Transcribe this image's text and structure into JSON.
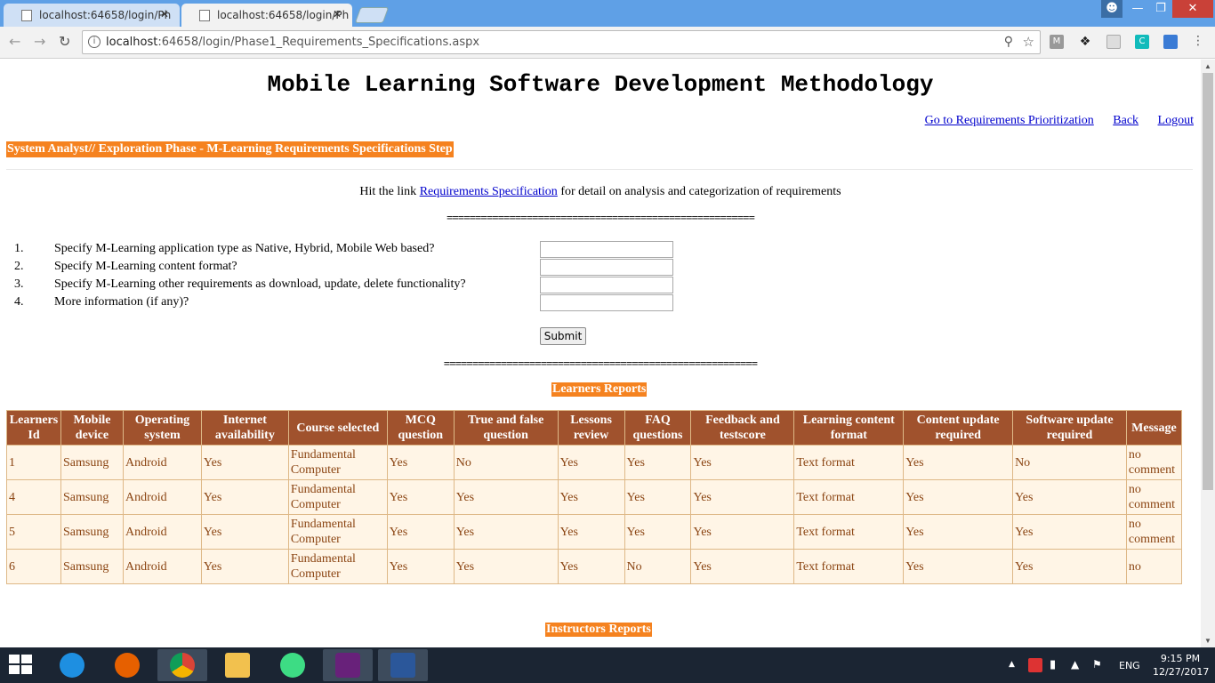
{
  "browser": {
    "tabs": [
      {
        "title": "localhost:64658/login/Ph",
        "close": "✕"
      },
      {
        "title": "localhost:64658/login/Ph",
        "close": "✕"
      }
    ],
    "url_host": "localhost",
    "url_rest": ":64658/login/Phase1_Requirements_Specifications.aspx",
    "ext_m_label": "M",
    "ext_c_label": "C"
  },
  "page": {
    "title": "Mobile Learning Software Development Methodology",
    "links": {
      "prioritization": "Go to Requirements Prioritization",
      "back": "Back",
      "logout": "Logout"
    },
    "phase_label": "System Analyst//  Exploration Phase - M-Learning Requirements Specifications Step",
    "hint_before": "Hit the link ",
    "hint_link": "Requirements Specification",
    "hint_after": "  for detail on  analysis and categorization of requirements",
    "divider1": "======================================================",
    "divider2": "=======================================================",
    "questions": [
      {
        "num": "1.",
        "text": "Specify M-Learning application type as Native, Hybrid, Mobile Web based?",
        "value": ""
      },
      {
        "num": "2.",
        "text": "Specify M-Learning content format?",
        "value": ""
      },
      {
        "num": "3.",
        "text": "Specify M-Learning other requirements as download, update, delete functionality?",
        "value": ""
      },
      {
        "num": "4.",
        "text": "More information (if any)?",
        "value": ""
      }
    ],
    "submit_label": "Submit",
    "learners_reports_label": "Learners Reports",
    "instructors_reports_label": "Instructors Reports",
    "learners_table": {
      "headers": [
        "Learners Id",
        "Mobile device",
        "Operating system",
        "Internet availability",
        "Course selected",
        "MCQ question",
        "True and false question",
        "Lessons review",
        "FAQ questions",
        "Feedback and testscore",
        "Learning content format",
        "Content update required",
        "Software update required",
        "Message"
      ],
      "rows": [
        [
          "1",
          "Samsung",
          "Android",
          "Yes",
          "Fundamental Computer",
          "Yes",
          "No",
          "Yes",
          "Yes",
          "Yes",
          "Text format",
          "Yes",
          "No",
          "no comment"
        ],
        [
          "4",
          "Samsung",
          "Android",
          "Yes",
          "Fundamental Computer",
          "Yes",
          "Yes",
          "Yes",
          "Yes",
          "Yes",
          "Text format",
          "Yes",
          "Yes",
          "no comment"
        ],
        [
          "5",
          "Samsung",
          "Android",
          "Yes",
          "Fundamental Computer",
          "Yes",
          "Yes",
          "Yes",
          "Yes",
          "Yes",
          "Text format",
          "Yes",
          "Yes",
          "no comment"
        ],
        [
          "6",
          "Samsung",
          "Android",
          "Yes",
          "Fundamental Computer",
          "Yes",
          "Yes",
          "Yes",
          "No",
          "Yes",
          "Text format",
          "Yes",
          "Yes",
          "no"
        ]
      ]
    }
  },
  "taskbar": {
    "lang": "ENG",
    "time": "9:15 PM",
    "date": "12/27/2017",
    "apps": [
      "ie-icon",
      "firefox-icon",
      "chrome-icon",
      "file-explorer-icon",
      "android-studio-icon",
      "visual-studio-icon",
      "word-icon"
    ]
  },
  "colors": {
    "header_bg": "#a0522d",
    "cell_bg": "#fff5e6",
    "cell_text": "#8b4513",
    "label_bg": "#f5821f",
    "link": "#0000cc"
  }
}
